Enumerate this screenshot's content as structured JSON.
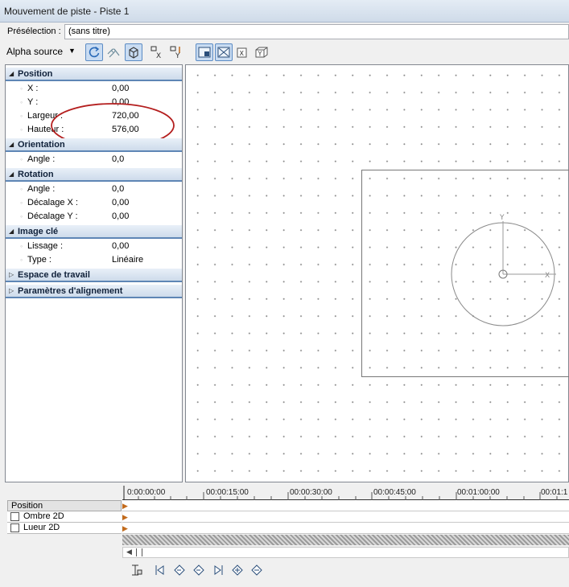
{
  "window": {
    "title": "Mouvement de piste - Piste 1"
  },
  "preset": {
    "label": "Présélection :",
    "value": "(sans titre)"
  },
  "toolbar": {
    "alpha_label": "Alpha source",
    "buttons": [
      {
        "icon": "rotate-icon",
        "active": true
      },
      {
        "icon": "snap-icon",
        "active": false
      },
      {
        "icon": "3d-box-icon",
        "active": true
      },
      {
        "icon": "lock-x-icon",
        "active": false
      },
      {
        "icon": "lock-y-icon",
        "active": false
      },
      {
        "icon": "view-mode-1-icon",
        "active": true
      },
      {
        "icon": "view-mode-2-icon",
        "active": true
      },
      {
        "icon": "x-axis-icon",
        "active": false
      },
      {
        "icon": "y-axis-icon",
        "active": false
      }
    ]
  },
  "properties": {
    "position": {
      "title": "Position",
      "x_label": "X :",
      "x_value": "0,00",
      "y_label": "Y :",
      "y_value": "0,00",
      "width_label": "Largeur :",
      "width_value": "720,00",
      "height_label": "Hauteur :",
      "height_value": "576,00"
    },
    "orientation": {
      "title": "Orientation",
      "angle_label": "Angle :",
      "angle_value": "0,0"
    },
    "rotation": {
      "title": "Rotation",
      "angle_label": "Angle :",
      "angle_value": "0,0",
      "offset_x_label": "Décalage X :",
      "offset_x_value": "0,00",
      "offset_y_label": "Décalage Y :",
      "offset_y_value": "0,00"
    },
    "keyframe": {
      "title": "Image clé",
      "smooth_label": "Lissage :",
      "smooth_value": "0,00",
      "type_label": "Type :",
      "type_value": "Linéaire"
    },
    "workspace": {
      "title": "Espace de travail"
    },
    "alignment": {
      "title": "Paramètres d'alignement"
    }
  },
  "canvas": {
    "y_axis_label": "Y",
    "x_axis_label": "X"
  },
  "timeline": {
    "header": "Position",
    "tracks": [
      "Ombre 2D",
      "Lueur 2D"
    ],
    "ruler_labels": [
      "0:00:00:00",
      "00:00:15:00",
      "00:00:30:00",
      "00:00:45:00",
      "00:01:00:00",
      "00:01:1"
    ]
  }
}
